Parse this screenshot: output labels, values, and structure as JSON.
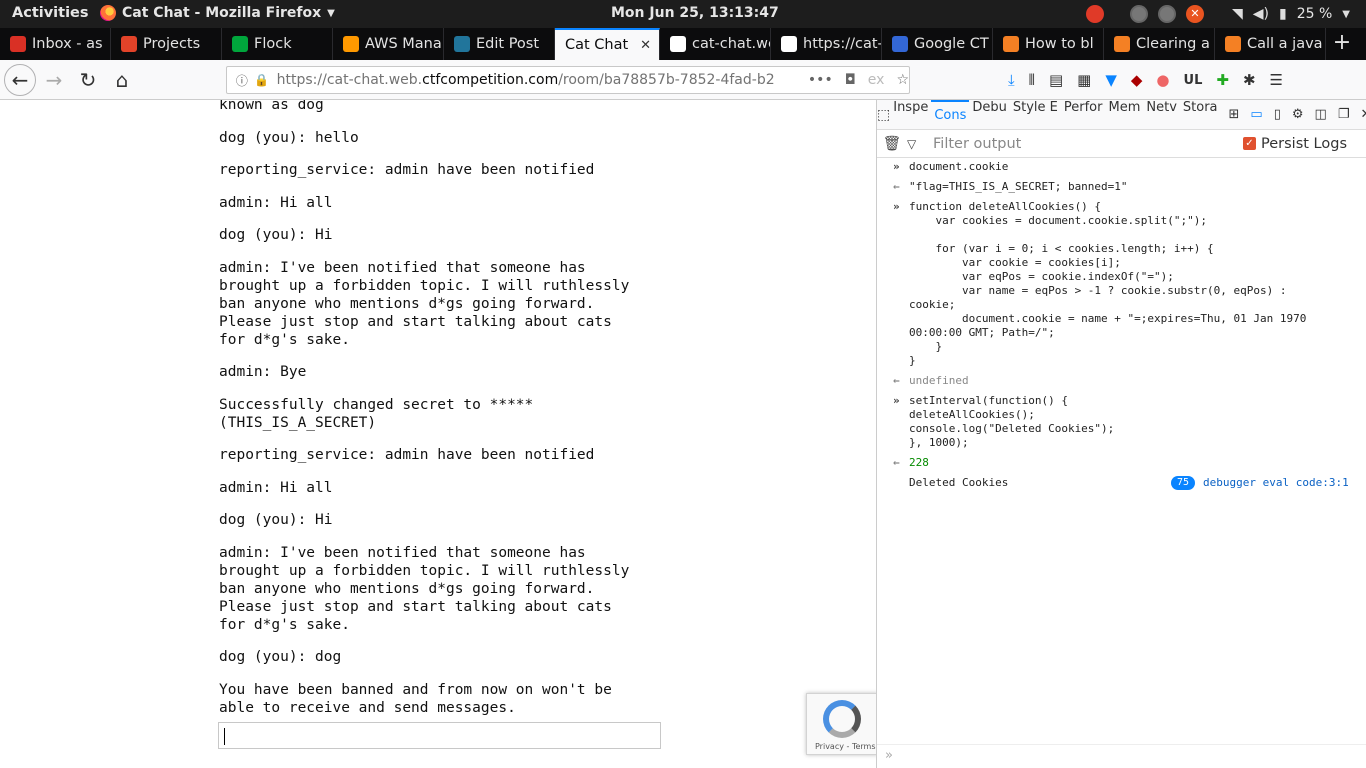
{
  "topbar": {
    "activities": "Activities",
    "app_title": "Cat Chat - Mozilla Firefox",
    "clock": "Mon Jun 25, 13:13:47",
    "battery": "25 %"
  },
  "tabs": [
    {
      "label": "Inbox - as",
      "color": "#d93025"
    },
    {
      "label": "Projects",
      "color": "#e24329"
    },
    {
      "label": "Flock",
      "color": "#00a63c"
    },
    {
      "label": "AWS Mana",
      "color": "#ff9900"
    },
    {
      "label": "Edit Post",
      "color": "#21759b"
    },
    {
      "label": "Cat Chat",
      "color": "#ffffff"
    },
    {
      "label": "cat-chat.web.",
      "color": "#ffffff"
    },
    {
      "label": "https://cat-ch",
      "color": "#ffffff"
    },
    {
      "label": "Google CT",
      "color": "#3367d6"
    },
    {
      "label": "How to bl",
      "color": "#f48024"
    },
    {
      "label": "Clearing a",
      "color": "#f48024"
    },
    {
      "label": "Call a java",
      "color": "#f48024"
    }
  ],
  "active_tab_index": 5,
  "navbar": {
    "url_prefix": "https://cat-chat.web.",
    "url_domain": "ctfcompetition.com",
    "url_path": "/room/ba78857b-7852-4fad-b2",
    "url_more": "ex",
    "ext_label": "UL"
  },
  "chat": {
    "messages": [
      "known as dog",
      "dog (you): hello",
      "reporting_service: admin have been notified",
      "admin: Hi all",
      "dog (you): Hi",
      "admin: I've been notified that someone has\nbrought up a forbidden topic. I will ruthlessly\nban anyone who mentions d*gs going forward.\nPlease just stop and start talking about cats\nfor d*g's sake.",
      "admin: Bye",
      "Successfully changed secret to *****\n(THIS_IS_A_SECRET)",
      "reporting_service: admin have been notified",
      "admin: Hi all",
      "dog (you): Hi",
      "admin: I've been notified that someone has\nbrought up a forbidden topic. I will ruthlessly\nban anyone who mentions d*gs going forward.\nPlease just stop and start talking about cats\nfor d*g's sake.",
      "dog (you): dog",
      "You have been banned and from now on won't be\nable to receive and send messages."
    ],
    "input_value": ""
  },
  "recaptcha": {
    "terms": "Privacy - Terms"
  },
  "devtools": {
    "tabs": [
      "Inspe",
      "Cons",
      "Debu",
      "Style E",
      "Perfor",
      "Mem",
      "Netv",
      "Stora"
    ],
    "selected_tab": 1,
    "filter_placeholder": "Filter output",
    "persist_logs": "Persist Logs",
    "console": [
      {
        "kind": "input",
        "text": "document.cookie"
      },
      {
        "kind": "result",
        "text": "\"flag=THIS_IS_A_SECRET; banned=1\""
      },
      {
        "kind": "input",
        "text": "function deleteAllCookies() {\n    var cookies = document.cookie.split(\";\");\n\n    for (var i = 0; i < cookies.length; i++) {\n        var cookie = cookies[i];\n        var eqPos = cookie.indexOf(\"=\");\n        var name = eqPos > -1 ? cookie.substr(0, eqPos) :\ncookie;\n        document.cookie = name + \"=;expires=Thu, 01 Jan 1970\n00:00:00 GMT; Path=/\";\n    }\n}"
      },
      {
        "kind": "undef",
        "text": "undefined"
      },
      {
        "kind": "input",
        "text": "setInterval(function() {\ndeleteAllCookies();\nconsole.log(\"Deleted Cookies\");\n}, 1000);"
      },
      {
        "kind": "num",
        "text": "228"
      },
      {
        "kind": "log",
        "text": "Deleted Cookies",
        "count": "75",
        "source": "debugger eval code:3:1"
      }
    ]
  }
}
